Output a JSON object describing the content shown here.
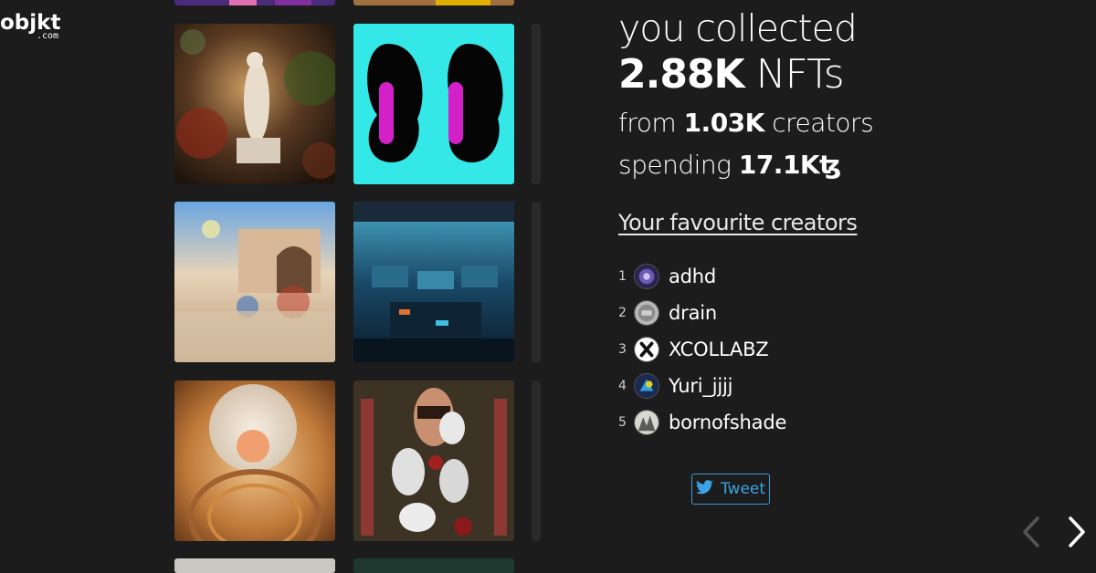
{
  "brand": {
    "logo_main": "objkt",
    "logo_sub": ".com"
  },
  "stats": {
    "line1": "you collected",
    "nfts_value": "2.88K",
    "nfts_label": "NFTs",
    "creators_prefix": "from",
    "creators_value": "1.03K",
    "creators_label": "creators",
    "spending_prefix": "spending",
    "spending_value": "17.1K",
    "currency_symbol": "ꜩ"
  },
  "favourites": {
    "title": "Your favourite creators",
    "creators": [
      {
        "rank": "1",
        "name": "adhd",
        "avatar": "adhd-avatar"
      },
      {
        "rank": "2",
        "name": "drain",
        "avatar": "drain-avatar"
      },
      {
        "rank": "3",
        "name": "XCOLLABZ",
        "avatar": "xcollabz-avatar"
      },
      {
        "rank": "4",
        "name": "Yuri_jjjj",
        "avatar": "yuri-avatar"
      },
      {
        "rank": "5",
        "name": "bornofshade",
        "avatar": "bornofshade-avatar"
      }
    ]
  },
  "share": {
    "tweet_label": "Tweet",
    "icon": "twitter-bird-icon"
  },
  "navigation": {
    "prev_icon": "chevron-left-icon",
    "next_icon": "chevron-right-icon"
  },
  "colors": {
    "background": "#1c1c1c",
    "tweet_blue": "#3ba3e6",
    "cyan_art": "#33e6e6",
    "magenta_art": "#e020c0"
  }
}
